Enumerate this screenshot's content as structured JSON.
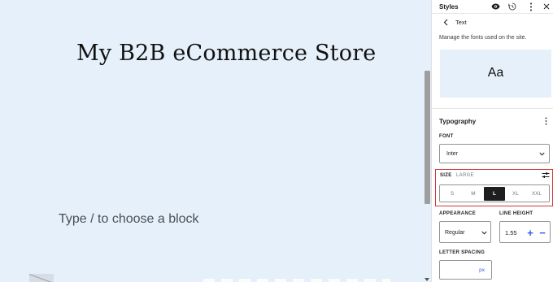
{
  "canvas": {
    "site_title": "My B2B eCommerce Store",
    "block_placeholder": "Type / to choose a block"
  },
  "sidebar": {
    "title": "Styles",
    "icons": {
      "view": "eye-icon",
      "revisions": "history-icon",
      "more": "kebab-icon",
      "close": "close-icon"
    },
    "nav": {
      "back_icon": "chevron-left-icon",
      "title": "Text"
    },
    "description": "Manage the fonts used on the site.",
    "preview_text": "Aa",
    "typography": {
      "title": "Typography",
      "font_label": "FONT",
      "font_value": "Inter",
      "size_label": "SIZE",
      "size_current": "LARGE",
      "size_options": [
        "S",
        "M",
        "L",
        "XL",
        "XXL"
      ],
      "size_selected": "L",
      "appearance_label": "APPEARANCE",
      "appearance_value": "Regular",
      "line_height_label": "LINE HEIGHT",
      "line_height_value": "1.55",
      "letter_spacing_label": "LETTER SPACING",
      "letter_spacing_unit": "px"
    }
  },
  "colors": {
    "canvas_bg": "#e5f0fa",
    "accent": "#3858e9",
    "highlight": "#d63638",
    "selected_bg": "#1e1e1e"
  }
}
